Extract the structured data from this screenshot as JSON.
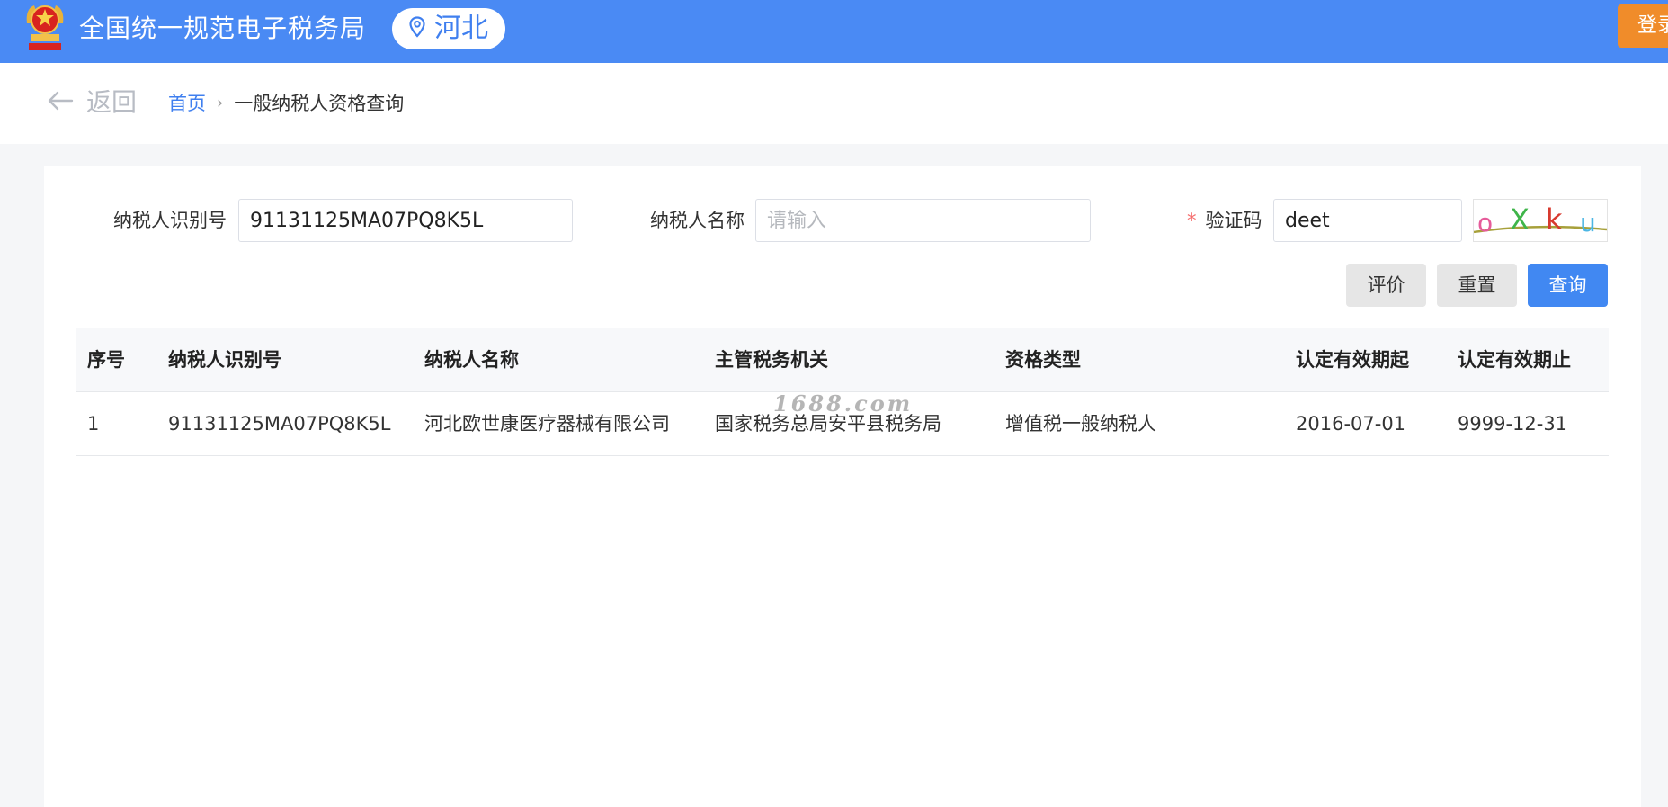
{
  "header": {
    "app_title": "全国统一规范电子税务局",
    "region": "河北",
    "login_label": "登录"
  },
  "breadcrumb": {
    "back_label": "返回",
    "home": "首页",
    "separator": "›",
    "current": "一般纳税人资格查询"
  },
  "form": {
    "taxpayer_id_label": "纳税人识别号",
    "taxpayer_id_value": "91131125MA07PQ8K5L",
    "taxpayer_name_label": "纳税人名称",
    "taxpayer_name_placeholder": "请输入",
    "captcha_required_mark": "*",
    "captcha_label": "验证码",
    "captcha_value": "deet",
    "captcha_chars": [
      "o",
      "X",
      "k",
      "u"
    ]
  },
  "buttons": {
    "evaluate": "评价",
    "reset": "重置",
    "query": "查询"
  },
  "table": {
    "headers": [
      "序号",
      "纳税人识别号",
      "纳税人名称",
      "主管税务机关",
      "资格类型",
      "认定有效期起",
      "认定有效期止"
    ],
    "rows": [
      [
        "1",
        "91131125MA07PQ8K5L",
        "河北欧世康医疗器械有限公司",
        "国家税务总局安平县税务局",
        "增值税一般纳税人",
        "2016-07-01",
        "9999-12-31"
      ]
    ]
  },
  "watermark": "1688.com",
  "colors": {
    "header_bg": "#4a8af4",
    "primary": "#4188f2",
    "login_orange": "#f08c2a",
    "required_red": "#f56c6c"
  },
  "icons": {
    "emblem": "national-tax-emblem",
    "location": "location-pin-icon",
    "back": "back-arrow-icon"
  }
}
